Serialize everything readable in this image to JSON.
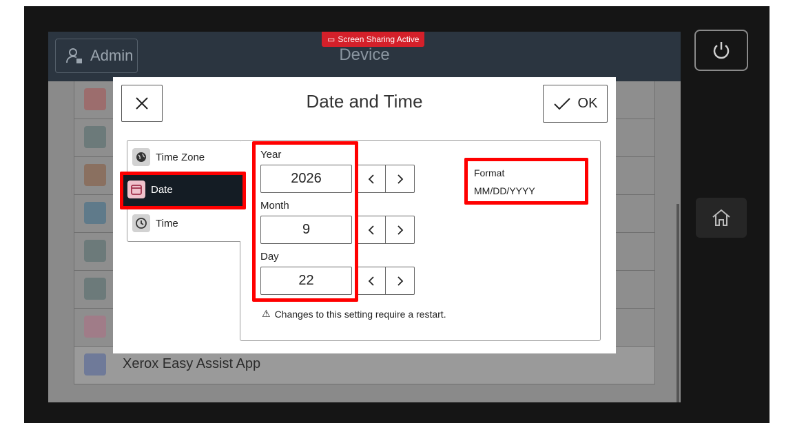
{
  "header": {
    "admin_label": "Admin",
    "device_title": "Device",
    "screen_sharing_badge": "Screen Sharing Active"
  },
  "background_list": {
    "last_item_label": "Xerox Easy Assist App"
  },
  "dialog": {
    "title": "Date and Time",
    "ok_label": "OK",
    "nav": [
      {
        "label": "Time Zone",
        "icon": "globe-icon"
      },
      {
        "label": "Date",
        "icon": "calendar-icon",
        "selected": true
      },
      {
        "label": "Time",
        "icon": "clock-icon"
      }
    ],
    "year": {
      "label": "Year",
      "value": "2026"
    },
    "month": {
      "label": "Month",
      "value": "9"
    },
    "day": {
      "label": "Day",
      "value": "22"
    },
    "format": {
      "label": "Format",
      "value": "MM/DD/YYYY"
    },
    "notice": "Changes to this setting require a restart."
  },
  "colors": {
    "highlight": "#ff0000",
    "selected_nav_bg": "#141c24",
    "badge_bg": "#d4202a"
  }
}
